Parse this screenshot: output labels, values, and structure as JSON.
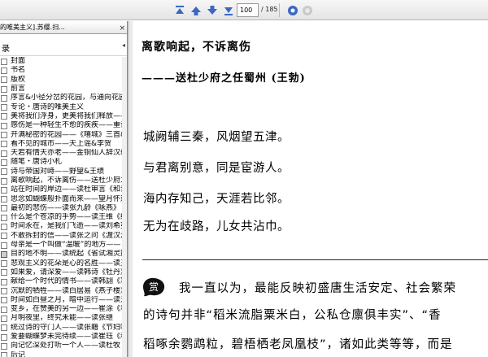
{
  "toolbar": {
    "page_current": "100",
    "page_total": "/ 185",
    "icons": [
      "first-page-icon",
      "prev-page-icon",
      "next-page-icon",
      "last-page-icon",
      "zoom-icon",
      "zoom-secondary-icon"
    ]
  },
  "sidebar": {
    "doc_tab": "的唯美主义].苏缨.扫...",
    "tab_close": "×",
    "panel_title": "录",
    "collapse_glyph": "◂",
    "selected_index": 21,
    "items": [
      "封面",
      "书名",
      "版权",
      "前言",
      "序言&小径分岔的花园，与通向花园",
      "专论・唐诗的唯美主义",
      "美将我们浮身，更美将我们释放——",
      "感伤是一种轻生不愈的疾疾——重读",
      "开满秘密的花园——《嘻城》三首&",
      "看不见的城市——天上谣&李贺",
      "天若有情天亦老——金铜仙人辞汉歌",
      "随笔・唐诗小札",
      "诗与帝国对峙——野望&王绩",
      "离歌响起，不诉离伤——送杜少府之",
      "站在时间的岸边——读杜审言《和晋",
      "思念如蝴蝶般扑面而来——望月怀远",
      "最初的悲伤——读张九龄《咏燕》",
      "什么是个苍凉的手势——读王维《终",
      "时间永在，是我们飞逝——读刘希夷",
      "不敢拆封的信——读张之问《渡汉江》",
      "母亲是一个叫做“温暖”的地方——",
      "目的地不明——读统起《省试湘灵鼓",
      "悲观主义的花朵是心的名胜——读王",
      "如果爱，请深爱——读韩诗《牡丹》",
      "献给一个时代的情书——读韩翃《寒",
      "沉默的牺牲——读白居易《燕子楼》",
      "时间如白昼之月，暗中运行——读元",
      "变乡，在赞美的另一边——崔涂《春夕",
      "月明夜里，终究未能——读张继",
      "统过诗的守门人——读张籍《节妇吟",
      "爱要蝴蝶梦未完待续——读崔珏《和",
      "向记忆深处打听一个人——读杜牧《",
      "后记"
    ]
  },
  "document": {
    "heading": "离歌响起，不诉离伤",
    "subtitle": "———送杜少府之任蜀州 (王勃)",
    "poem": [
      "城阙辅三秦，风烟望五津。",
      "与君离别意，同是宦游人。",
      "海内存知己，天涯若比邻。",
      "无为在歧路，儿女共沾巾。"
    ],
    "essay_badge_text": "赏",
    "paragraph": [
      "我一直以为，最能反映初盛唐生活安定、社会繁荣",
      "的诗句并非“稻米流脂粟米白，公私仓廪俱丰实”、“香",
      "稻啄余鹦鹉粒，碧梧栖老凤凰枝”，诸如此类等等，而是"
    ]
  },
  "colors": {
    "toolbar_icon": "#3b67c4",
    "toolbar_bg": "#ececec"
  }
}
